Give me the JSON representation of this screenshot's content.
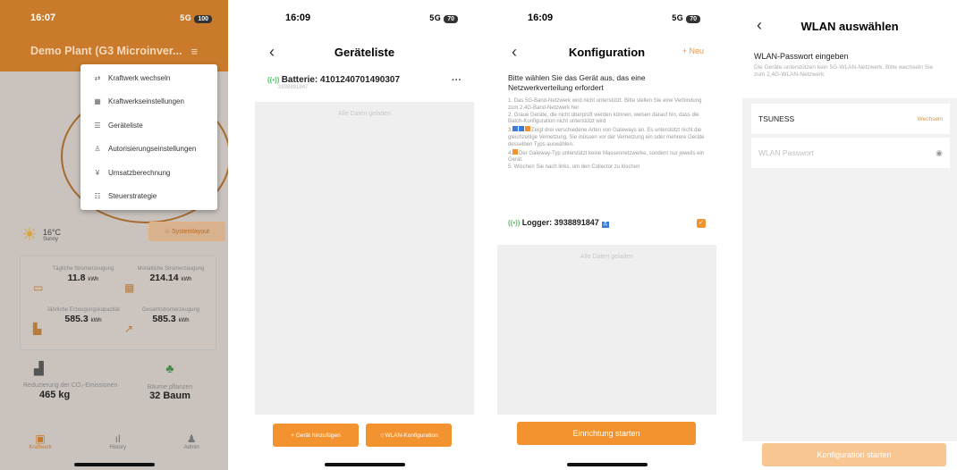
{
  "screen1": {
    "time": "16:07",
    "signal": "5G",
    "battery": "100",
    "plant_name": "Demo Plant (G3 Microinver...",
    "menu": [
      {
        "label": "Kraftwerk wechseln",
        "icon": "swap-icon"
      },
      {
        "label": "Kraftwerkseinstellungen",
        "icon": "settings-icon"
      },
      {
        "label": "Geräteliste",
        "icon": "list-icon"
      },
      {
        "label": "Autorisierungseinstellungen",
        "icon": "user-icon"
      },
      {
        "label": "Umsatzberechnung",
        "icon": "money-icon"
      },
      {
        "label": "Steuerstrategie",
        "icon": "strategy-icon"
      }
    ],
    "temperature": "16°C",
    "weather": "Sunny",
    "system_layout_label": "Systemlayout",
    "stats": [
      {
        "label": "Tägliche Stromerzeugung",
        "value": "11.8",
        "unit": "kWh"
      },
      {
        "label": "Monatliche Stromerzeugung",
        "value": "214.14",
        "unit": "kWh"
      },
      {
        "label": "Jährliche Erzeugungskapazität",
        "value": "585.3",
        "unit": "kWh"
      },
      {
        "label": "Gesamtstromerzeugung",
        "value": "585.3",
        "unit": "kWh"
      }
    ],
    "co2_label": "Reduzierung der CO₂-Emissionen",
    "co2_value": "465 kg",
    "trees_label": "Bäume pflanzen",
    "trees_value": "32 Baum",
    "tabs": [
      {
        "label": "Kraftwerk",
        "icon": "plant-icon"
      },
      {
        "label": "History",
        "icon": "chart-icon"
      },
      {
        "label": "Admin",
        "icon": "person-icon"
      }
    ]
  },
  "screen2": {
    "time": "16:09",
    "signal": "5G",
    "battery": "70",
    "title": "Geräteliste",
    "device_name": "Batterie: 4101240701490307",
    "device_sub": "3938891847",
    "more": "···",
    "no_more": "Alle Daten geladen",
    "add_label": "+ Gerät hinzufügen",
    "wlan_label": "WLAN-Konfiguration"
  },
  "screen3": {
    "time": "16:09",
    "signal": "5G",
    "battery": "70",
    "title": "Konfiguration",
    "new_label": "+ Neu",
    "intro": "Bitte wählen Sie das Gerät aus, das eine Netzwerkverteilung erfordert",
    "note1": "1. Das 5G-Band-Netzwerk wird nicht unterstützt. Bitte stellen Sie eine Verbindung zum 2,4G-Band-Netzwerk her",
    "note2": "2. Graue Geräte, die nicht überprüft werden können, weisen darauf hin, dass die Batch-Konfiguration nicht unterstützt wird",
    "note3": "Zeigt drei verschiedene Arten von Gateways an. Es unterstützt nicht die gleichzeitige Vernetzung. Sie müssen vor der Vernetzung ein oder mehrere Geräte desselben Typs auswählen.",
    "note4": "Der Gateway-Typ unterstützt keine Massennetzwerke, sondern nur jeweils ein Gerät.",
    "note5": "5. Wischen Sie nach links, um den Collector zu löschen",
    "logger": "Logger: 3938891847",
    "no_more": "Alle Daten geladen",
    "start_label": "Einrichtung starten"
  },
  "screen4": {
    "title": "WLAN auswählen",
    "pw_heading": "WLAN-Passwort eingeben",
    "pw_note": "Die Geräte unterstützen kein 5G-WLAN-Netzwerk. Bitte wechseln Sie zum 2,4G-WLAN-Netzwerk",
    "ssid": "TSUNESS",
    "change_label": "Wechseln",
    "password_placeholder": "WLAN Passwort",
    "start_label": "Konfiguration starten"
  }
}
